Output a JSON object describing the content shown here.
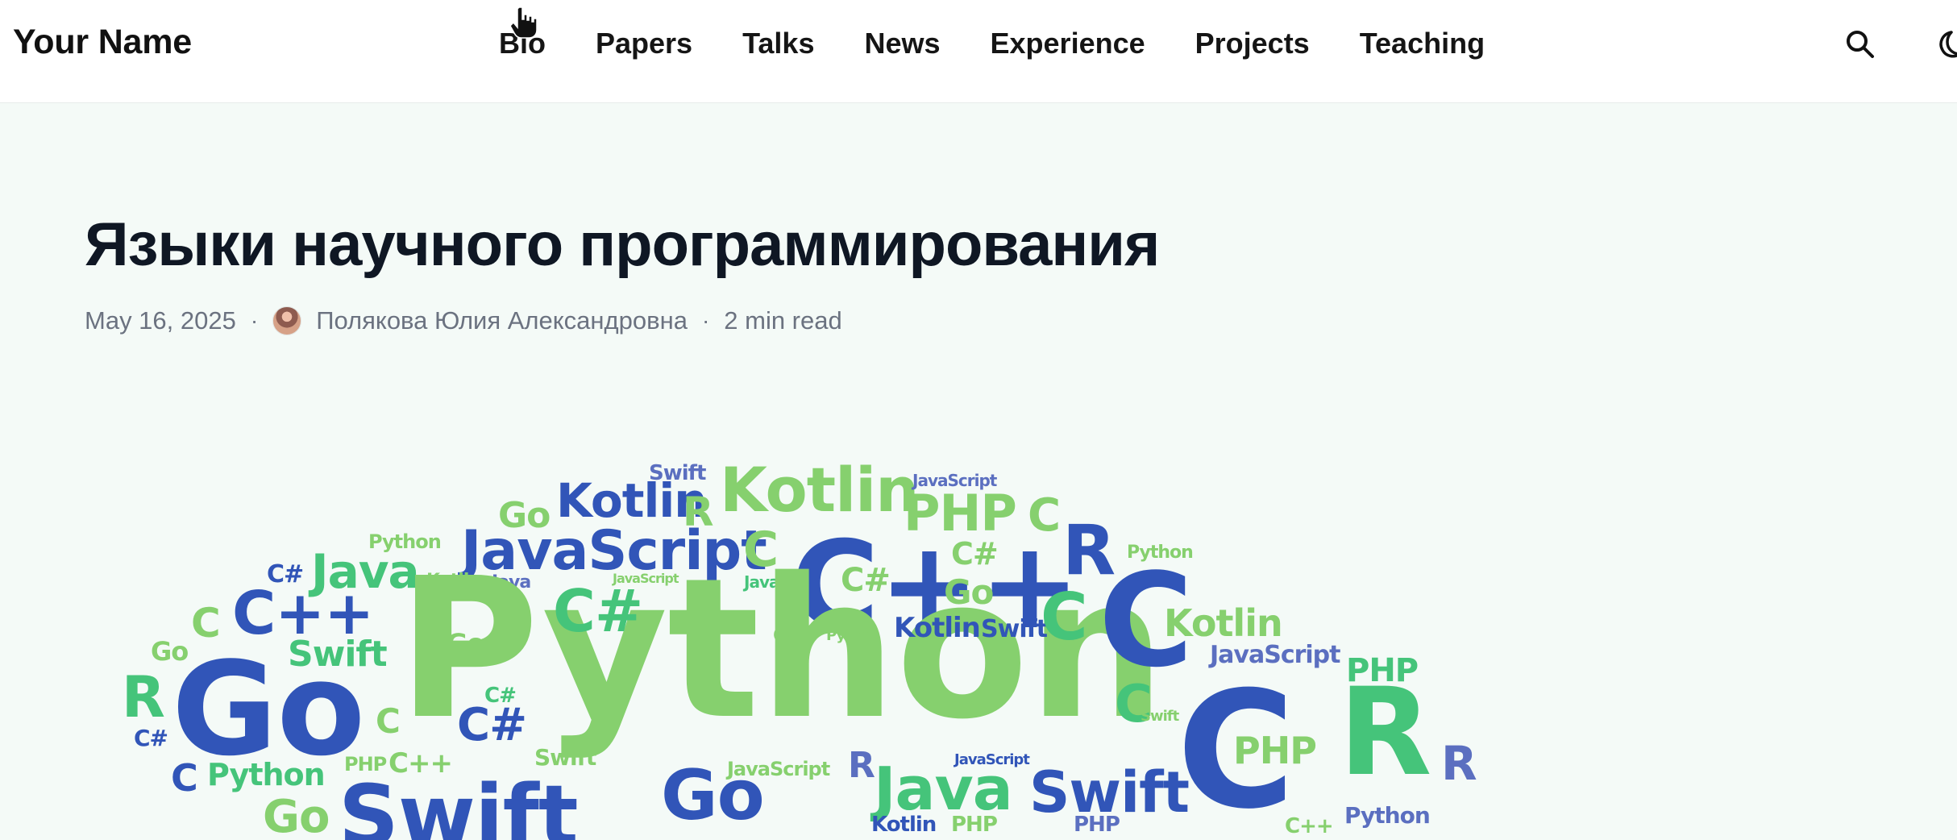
{
  "header": {
    "brand": "Your Name",
    "nav": [
      "Bio",
      "Papers",
      "Talks",
      "News",
      "Experience",
      "Projects",
      "Teaching"
    ],
    "tools": [
      "search-icon",
      "moon-icon"
    ]
  },
  "article": {
    "title": "Языки научного программирования",
    "date": "May 16, 2025",
    "separator": "·",
    "author": "Полякова Юлия Александровна",
    "read_time": "2 min read"
  },
  "word_cloud": {
    "words": {
      "kotlin_top": "Kotlin",
      "swift_top": "Swift",
      "go_top": "Go",
      "r_top": "R",
      "kotlin_big": "Kotlin",
      "javascript_small": "JavaScript",
      "php_top": "PHP",
      "c_top": "C",
      "python_small": "Python",
      "javascript_main": "JavaScript",
      "c_small_top": "C",
      "csharp_top": "C#",
      "cpp_big": "C++",
      "r_mid_top": "R",
      "python_right": "Python",
      "csharp_left": "C#",
      "java_left": "Java",
      "kotlin_tiny": "Kotlin",
      "java_tiny": "Java",
      "javascript_tiny": "JavaScript",
      "java_tiny2": "Java",
      "csharp_mid": "C#",
      "go_mid": "Go",
      "c_left_small": "C",
      "cpp_left": "C++",
      "python_main": "Python",
      "csharp_center": "C#",
      "kotlin_mid": "Kotlin",
      "swift_mid": "Swift",
      "c_mid_green": "C",
      "c_big": "C",
      "kotlin_right": "Kotlin",
      "javascript_right": "JavaScript",
      "go_small_left": "Go",
      "swift_left": "Swift",
      "go_small_inner": "Go",
      "cpp_small": "C++",
      "python_tiny": "Python",
      "php_right": "PHP",
      "r_left": "R",
      "go_big": "Go",
      "c_left_inner": "C",
      "csharp_small_left": "C#",
      "csharp_inner": "C#",
      "c_green_right": "C",
      "swift_small_right": "Swift",
      "c_right_big": "C",
      "r_big": "R",
      "php_mid": "PHP",
      "csharp_bottom_left": "C#",
      "php_bottom_left": "PHP",
      "cpp_bottom_left": "C++",
      "swift_bottom_small": "Swift",
      "javascript_bottom": "JavaScript",
      "r_bottom_mid": "R",
      "javascript_bottom_small": "JavaScript",
      "r_bottom_right": "R",
      "c_bottom_left": "C",
      "python_bottom_left": "Python",
      "go_bottom": "Go",
      "java_bottom": "Java",
      "swift_bottom": "Swift",
      "go_bottom_left": "Go",
      "swift_big_bottom": "Swift",
      "kotlin_bottom": "Kotlin",
      "php_bottom_small": "PHP",
      "php_bottom_right": "PHP",
      "cpp_bottom_right": "C++",
      "python_bottom_right": "Python"
    },
    "colors": {
      "green": "#86d06e",
      "blue": "#3155b8",
      "mint": "#45c47a",
      "periwinkle": "#5b6fc0"
    }
  }
}
